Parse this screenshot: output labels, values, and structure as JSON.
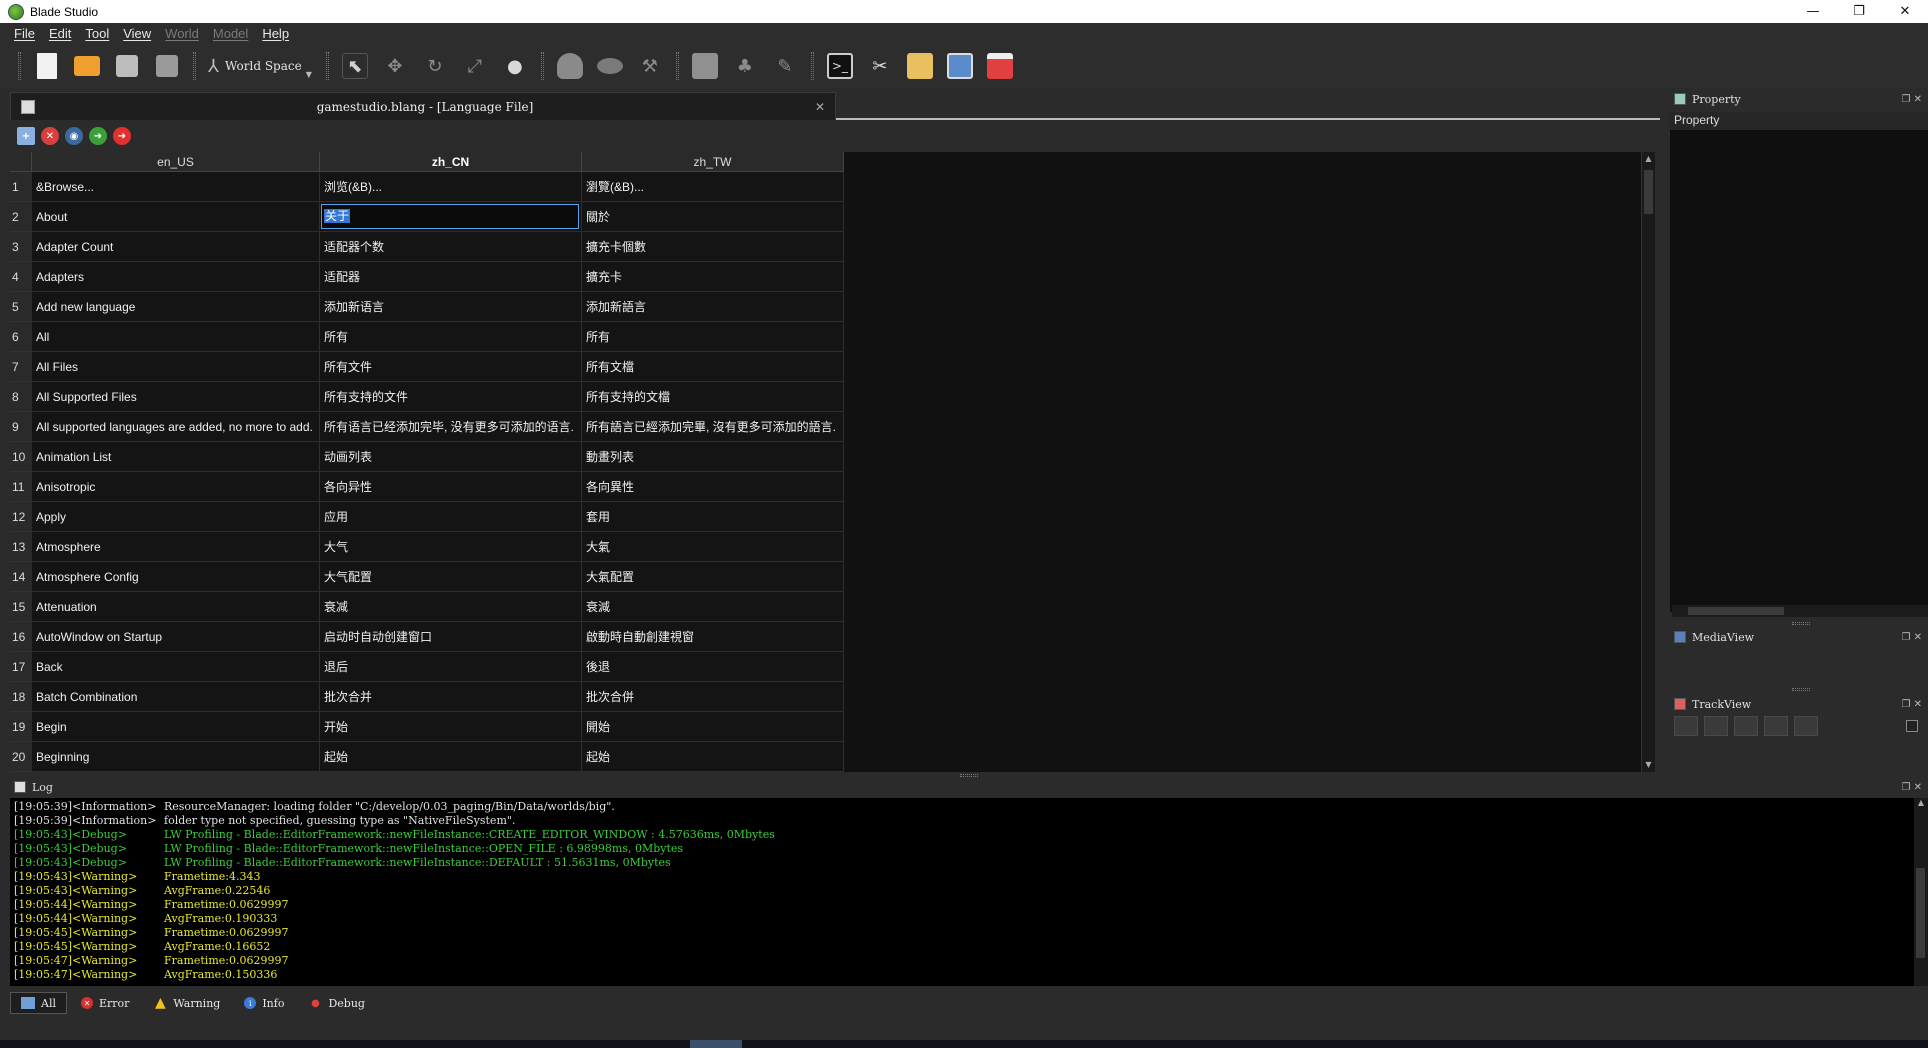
{
  "window": {
    "title": "Blade Studio",
    "controls": [
      "—",
      "❐",
      "✕"
    ]
  },
  "menu": [
    {
      "label": "File",
      "enabled": true
    },
    {
      "label": "Edit",
      "enabled": true
    },
    {
      "label": "Tool",
      "enabled": true
    },
    {
      "label": "View",
      "enabled": true
    },
    {
      "label": "World",
      "enabled": false
    },
    {
      "label": "Model",
      "enabled": false
    },
    {
      "label": "Help",
      "enabled": true
    }
  ],
  "toolbar": {
    "space_label": "World Space",
    "icons": {
      "new": "new-file-icon",
      "open": "open-folder-icon",
      "save": "save-icon",
      "save_all": "save-all-icon",
      "select": "select-arrow-icon",
      "move": "move-icon",
      "rotate": "rotate-icon",
      "scale": "scale-icon",
      "light": "lightbulb-icon",
      "terrain": "terrain-icon",
      "cloud": "cloud-icon",
      "tools": "tools-icon",
      "console": "console-icon",
      "settings": "settings-icon",
      "folder_export": "export-icon",
      "viewer": "image-viewer-icon",
      "media": "media-icon"
    }
  },
  "document": {
    "tab_title": "gamestudio.blang - [Language File]"
  },
  "table": {
    "columns": [
      "en_US",
      "zh_CN",
      "zh_TW"
    ],
    "active_column": "zh_CN",
    "editing": {
      "row": 2,
      "column": "zh_CN"
    },
    "rows": [
      {
        "n": "1",
        "en": "&Browse...",
        "cn": "浏览(&B)...",
        "tw": "瀏覽(&B)..."
      },
      {
        "n": "2",
        "en": "About",
        "cn": "关于",
        "tw": "關於"
      },
      {
        "n": "3",
        "en": "Adapter Count",
        "cn": "适配器个数",
        "tw": "擴充卡個數"
      },
      {
        "n": "4",
        "en": "Adapters",
        "cn": "适配器",
        "tw": "擴充卡"
      },
      {
        "n": "5",
        "en": "Add new language",
        "cn": "添加新语言",
        "tw": "添加新語言"
      },
      {
        "n": "6",
        "en": "All",
        "cn": "所有",
        "tw": "所有"
      },
      {
        "n": "7",
        "en": "All Files",
        "cn": "所有文件",
        "tw": "所有文檔"
      },
      {
        "n": "8",
        "en": "All Supported Files",
        "cn": "所有支持的文件",
        "tw": "所有支持的文檔"
      },
      {
        "n": "9",
        "en": "All supported languages are added, no more to add.",
        "cn": "所有语言已经添加完毕, 没有更多可添加的语言.",
        "tw": "所有語言已經添加完畢, 沒有更多可添加的語言."
      },
      {
        "n": "10",
        "en": "Animation List",
        "cn": "动画列表",
        "tw": "動畫列表"
      },
      {
        "n": "11",
        "en": "Anisotropic",
        "cn": "各向异性",
        "tw": "各向異性"
      },
      {
        "n": "12",
        "en": "Apply",
        "cn": "应用",
        "tw": "套用"
      },
      {
        "n": "13",
        "en": "Atmosphere",
        "cn": "大气",
        "tw": "大氣"
      },
      {
        "n": "14",
        "en": "Atmosphere Config",
        "cn": "大气配置",
        "tw": "大氣配置"
      },
      {
        "n": "15",
        "en": "Attenuation",
        "cn": "衰减",
        "tw": "衰減"
      },
      {
        "n": "16",
        "en": "AutoWindow on Startup",
        "cn": "启动时自动创建窗口",
        "tw": "啟動時自動創建視窗"
      },
      {
        "n": "17",
        "en": "Back",
        "cn": "退后",
        "tw": "後退"
      },
      {
        "n": "18",
        "en": "Batch Combination",
        "cn": "批次合并",
        "tw": "批次合併"
      },
      {
        "n": "19",
        "en": "Begin",
        "cn": "开始",
        "tw": "開始"
      },
      {
        "n": "20",
        "en": "Beginning",
        "cn": "起始",
        "tw": "起始"
      }
    ]
  },
  "panels": {
    "property": {
      "title": "Property",
      "header": "Property"
    },
    "mediaview": {
      "title": "MediaView"
    },
    "trackview": {
      "title": "TrackView"
    },
    "log": {
      "title": "Log"
    }
  },
  "log": {
    "colors": {
      "Information": "#e0e0e0",
      "Debug": "#3ccc3c",
      "Warning": "#e8e830"
    },
    "lines": [
      {
        "ts": "[19:05:39]<Information>",
        "level": "Information",
        "msg": "ResourceManager: loading folder \"C:/develop/0.03_paging/Bin/Data/worlds/big\"."
      },
      {
        "ts": "[19:05:39]<Information>",
        "level": "Information",
        "msg": "folder type not specified, guessing type as \"NativeFileSystem\"."
      },
      {
        "ts": "[19:05:43]<Debug>",
        "level": "Debug",
        "msg": "LW Profiling - Blade::EditorFramework::newFileInstance::CREATE_EDITOR_WINDOW : 4.57636ms, 0Mbytes"
      },
      {
        "ts": "[19:05:43]<Debug>",
        "level": "Debug",
        "msg": "LW Profiling - Blade::EditorFramework::newFileInstance::OPEN_FILE : 6.98998ms, 0Mbytes"
      },
      {
        "ts": "[19:05:43]<Debug>",
        "level": "Debug",
        "msg": "LW Profiling - Blade::EditorFramework::newFileInstance::DEFAULT : 51.5631ms, 0Mbytes"
      },
      {
        "ts": "[19:05:43]<Warning>",
        "level": "Warning",
        "msg": "Frametime:4.343"
      },
      {
        "ts": "[19:05:43]<Warning>",
        "level": "Warning",
        "msg": "AvgFrame:0.22546"
      },
      {
        "ts": "[19:05:44]<Warning>",
        "level": "Warning",
        "msg": "Frametime:0.0629997"
      },
      {
        "ts": "[19:05:44]<Warning>",
        "level": "Warning",
        "msg": "AvgFrame:0.190333"
      },
      {
        "ts": "[19:05:45]<Warning>",
        "level": "Warning",
        "msg": "Frametime:0.0629997"
      },
      {
        "ts": "[19:05:45]<Warning>",
        "level": "Warning",
        "msg": "AvgFrame:0.16652"
      },
      {
        "ts": "[19:05:47]<Warning>",
        "level": "Warning",
        "msg": "Frametime:0.0629997"
      },
      {
        "ts": "[19:05:47]<Warning>",
        "level": "Warning",
        "msg": "AvgFrame:0.150336"
      }
    ],
    "filters": [
      {
        "label": "All",
        "icon": "all-icon",
        "active": true
      },
      {
        "label": "Error",
        "icon": "error-icon",
        "active": false
      },
      {
        "label": "Warning",
        "icon": "warning-icon",
        "active": false
      },
      {
        "label": "Info",
        "icon": "info-icon",
        "active": false
      },
      {
        "label": "Debug",
        "icon": "debug-icon",
        "active": false
      }
    ]
  }
}
